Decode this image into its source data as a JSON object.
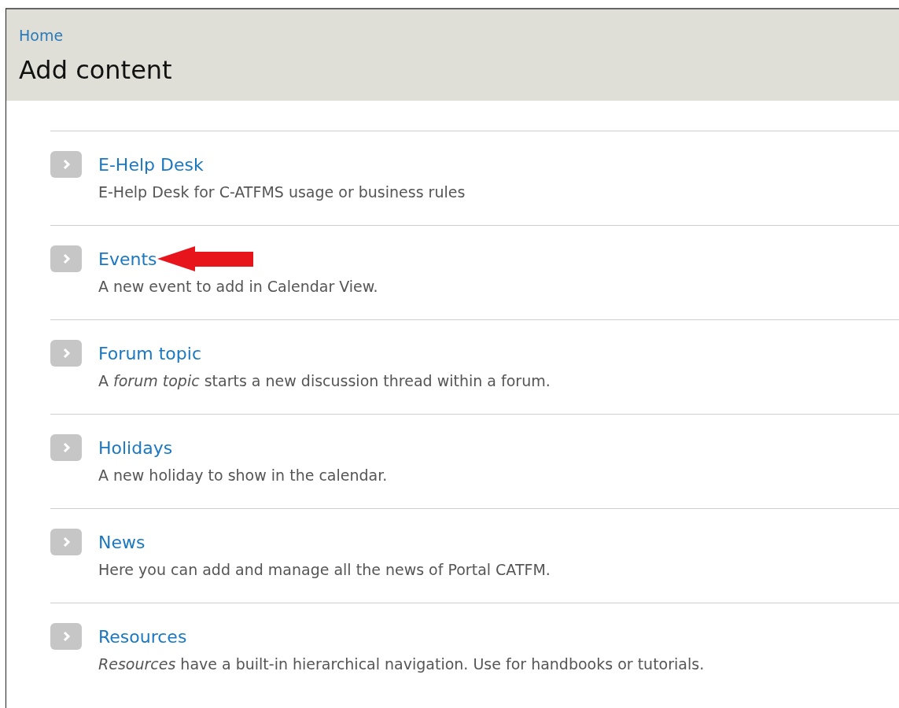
{
  "breadcrumb": "Home",
  "title": "Add content",
  "items": [
    {
      "name": "E-Help Desk",
      "description": "E-Help Desk for C-ATFMS usage or business rules",
      "marked": false
    },
    {
      "name": "Events",
      "description": "A new event to add in Calendar View.",
      "marked": true
    },
    {
      "name": "Forum topic",
      "description": "A *forum topic* starts a new discussion thread within a forum.",
      "marked": false
    },
    {
      "name": "Holidays",
      "description": "A new holiday to show in the calendar.",
      "marked": false
    },
    {
      "name": "News",
      "description": "Here you can add and manage all the news of Portal CATFM.",
      "marked": false
    },
    {
      "name": "Resources",
      "description": "*Resources* have a built-in hierarchical navigation. Use for handbooks or tutorials.",
      "marked": false
    }
  ]
}
